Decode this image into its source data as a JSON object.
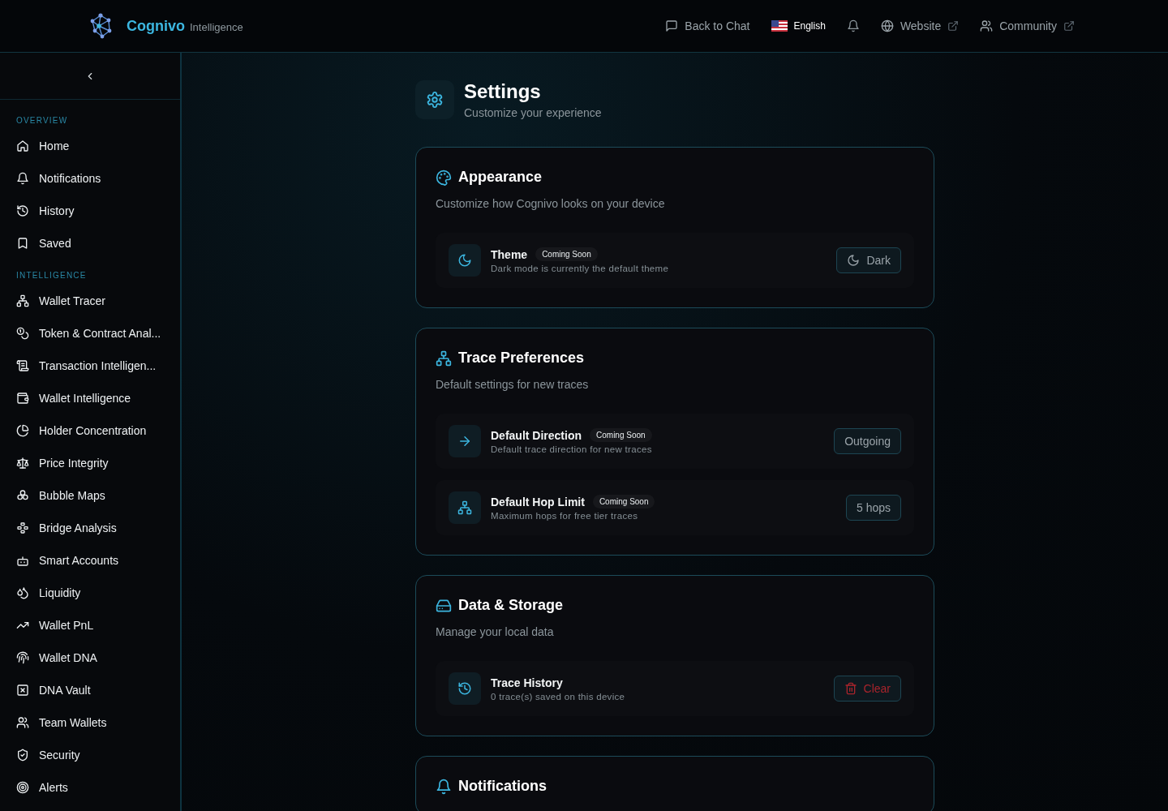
{
  "brand": {
    "name": "Cognivo",
    "tagline": "Intelligence"
  },
  "topbar": {
    "back": "Back to Chat",
    "language": "English",
    "links": [
      {
        "label": "Website"
      },
      {
        "label": "Community"
      }
    ]
  },
  "sidebar": {
    "groups": [
      {
        "label": "OVERVIEW",
        "items": [
          {
            "label": "Home",
            "selected": false
          },
          {
            "label": "Notifications",
            "selected": false
          },
          {
            "label": "History",
            "selected": false
          },
          {
            "label": "Saved",
            "selected": false
          }
        ]
      },
      {
        "label": "INTELLIGENCE",
        "items": [
          {
            "label": "Wallet Tracer",
            "selected": false
          },
          {
            "label": "Token & Contract Anal...",
            "selected": false
          },
          {
            "label": "Transaction Intelligen...",
            "selected": false
          },
          {
            "label": "Wallet Intelligence",
            "selected": false
          },
          {
            "label": "Holder Concentration",
            "selected": false
          },
          {
            "label": "Price Integrity",
            "selected": false
          },
          {
            "label": "Bubble Maps",
            "selected": false
          },
          {
            "label": "Bridge Analysis",
            "selected": false
          },
          {
            "label": "Smart Accounts",
            "selected": false
          },
          {
            "label": "Liquidity",
            "selected": false
          },
          {
            "label": "Wallet PnL",
            "selected": false
          },
          {
            "label": "Wallet DNA",
            "selected": false
          },
          {
            "label": "DNA Vault",
            "selected": false
          },
          {
            "label": "Team Wallets",
            "selected": false
          },
          {
            "label": "Security",
            "selected": false
          },
          {
            "label": "Alerts",
            "selected": false
          }
        ]
      }
    ]
  },
  "page": {
    "title": "Settings",
    "subtitle": "Customize your experience"
  },
  "sections": [
    {
      "title": "Appearance",
      "description": "Customize how Cognivo looks on your device",
      "rows": [
        {
          "title": "Theme",
          "badge": "Coming Soon",
          "description": "Dark mode is currently the default theme",
          "button": {
            "label": "Dark",
            "kind": "icon"
          }
        }
      ]
    },
    {
      "title": "Trace Preferences",
      "description": "Default settings for new traces",
      "rows": [
        {
          "title": "Default Direction",
          "badge": "Coming Soon",
          "description": "Default trace direction for new traces",
          "button": {
            "label": "Outgoing",
            "kind": "plain"
          }
        },
        {
          "title": "Default Hop Limit",
          "badge": "Coming Soon",
          "description": "Maximum hops for free tier traces",
          "button": {
            "label": "5 hops",
            "kind": "plain"
          }
        }
      ]
    },
    {
      "title": "Data & Storage",
      "description": "Manage your local data",
      "rows": [
        {
          "title": "Trace History",
          "description": "0 trace(s) saved on this device",
          "button": {
            "label": "Clear",
            "kind": "danger"
          }
        }
      ]
    },
    {
      "title": "Notifications"
    }
  ]
}
